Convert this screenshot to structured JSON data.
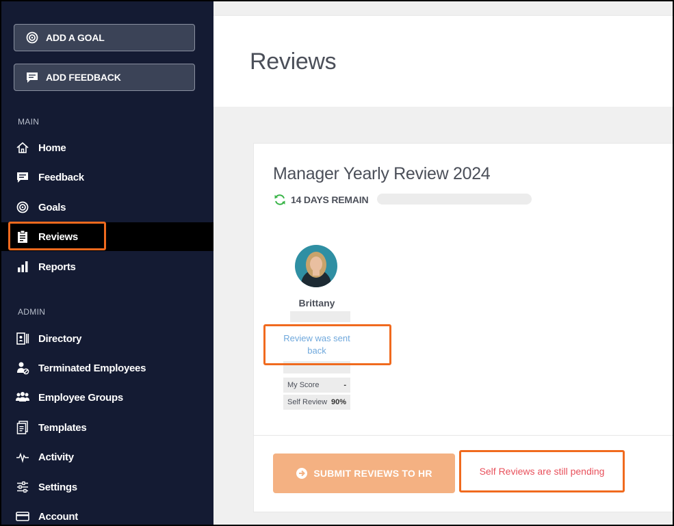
{
  "sidebar": {
    "add_goal_label": "ADD A GOAL",
    "add_feedback_label": "ADD FEEDBACK",
    "main_section": "MAIN",
    "admin_section": "ADMIN",
    "main_items": [
      {
        "label": "Home",
        "icon": "home-icon"
      },
      {
        "label": "Feedback",
        "icon": "feedback-icon"
      },
      {
        "label": "Goals",
        "icon": "target-icon"
      },
      {
        "label": "Reviews",
        "icon": "clipboard-icon",
        "active": true
      },
      {
        "label": "Reports",
        "icon": "bar-chart-icon"
      }
    ],
    "admin_items": [
      {
        "label": "Directory",
        "icon": "directory-icon"
      },
      {
        "label": "Terminated Employees",
        "icon": "terminated-user-icon"
      },
      {
        "label": "Employee Groups",
        "icon": "group-icon"
      },
      {
        "label": "Templates",
        "icon": "templates-icon"
      },
      {
        "label": "Activity",
        "icon": "activity-icon"
      },
      {
        "label": "Settings",
        "icon": "sliders-icon"
      },
      {
        "label": "Account",
        "icon": "card-icon"
      }
    ]
  },
  "header": {
    "title": "Reviews"
  },
  "review": {
    "title": "Manager Yearly Review 2024",
    "days_remain": "14 DAYS REMAIN",
    "employee": {
      "name": "Brittany",
      "status": "Review was sent back",
      "scores": [
        {
          "label": "My Score",
          "value": "-"
        },
        {
          "label": "Self Review",
          "value": "90%"
        }
      ]
    },
    "submit_label": "SUBMIT REVIEWS TO HR",
    "pending_message": "Self Reviews are still pending"
  },
  "colors": {
    "sidebar_bg": "#141b33",
    "highlight": "#f06a1e",
    "submit_bg": "#f4b182",
    "pending_text": "#e8505b",
    "link": "#6fa8dc",
    "refresh": "#3bb54a"
  }
}
